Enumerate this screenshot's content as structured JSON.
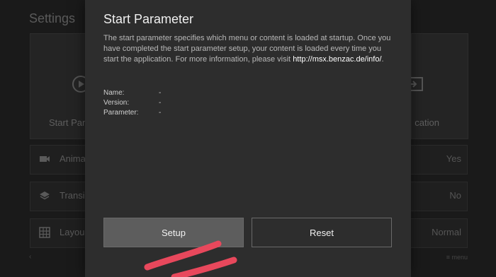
{
  "background": {
    "title": "Settings",
    "tile_left_label": "Start Para",
    "tile_right_label": "cation",
    "rows": [
      {
        "icon": "video-camera-icon",
        "label": "Anima",
        "value": "Yes"
      },
      {
        "icon": "layers-icon",
        "label": "Transi",
        "value": "No"
      },
      {
        "icon": "grid-icon",
        "label": "Layou",
        "value": "Normal"
      }
    ],
    "nav_left": "‹",
    "nav_right": "≡ menu"
  },
  "dialog": {
    "title": "Start Parameter",
    "description": "The start parameter specifies which menu or content is loaded at startup. Once you have completed the start parameter setup, your content is loaded every time you start the application. For more information, please visit ",
    "link": "http://msx.benzac.de/info/",
    "period": ".",
    "info": [
      {
        "key": "Name:",
        "value": "-"
      },
      {
        "key": "Version:",
        "value": "-"
      },
      {
        "key": "Parameter:",
        "value": "-"
      }
    ],
    "setup_label": "Setup",
    "reset_label": "Reset"
  },
  "annotation_color": "#e8485c"
}
